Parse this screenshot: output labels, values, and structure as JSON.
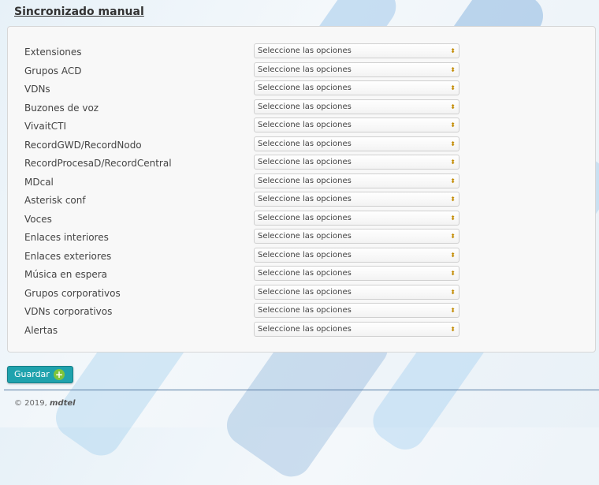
{
  "page": {
    "title": "Sincronizado manual"
  },
  "form": {
    "rows": [
      {
        "label": "Extensiones",
        "value": "Seleccione las opciones"
      },
      {
        "label": "Grupos ACD",
        "value": "Seleccione las opciones"
      },
      {
        "label": "VDNs",
        "value": "Seleccione las opciones"
      },
      {
        "label": "Buzones de voz",
        "value": "Seleccione las opciones"
      },
      {
        "label": "VivaitCTI",
        "value": "Seleccione las opciones"
      },
      {
        "label": "RecordGWD/RecordNodo",
        "value": "Seleccione las opciones"
      },
      {
        "label": "RecordProcesaD/RecordCentral",
        "value": "Seleccione las opciones"
      },
      {
        "label": "MDcal",
        "value": "Seleccione las opciones"
      },
      {
        "label": "Asterisk conf",
        "value": "Seleccione las opciones"
      },
      {
        "label": "Voces",
        "value": "Seleccione las opciones"
      },
      {
        "label": "Enlaces interiores",
        "value": "Seleccione las opciones"
      },
      {
        "label": "Enlaces exteriores",
        "value": "Seleccione las opciones"
      },
      {
        "label": "Música en espera",
        "value": "Seleccione las opciones"
      },
      {
        "label": "Grupos corporativos",
        "value": "Seleccione las opciones"
      },
      {
        "label": "VDNs corporativos",
        "value": "Seleccione las opciones"
      },
      {
        "label": "Alertas",
        "value": "Seleccione las opciones"
      }
    ],
    "arrow_glyph": "⬍"
  },
  "actions": {
    "save_label": "Guardar",
    "save_icon": "plus-icon",
    "save_icon_glyph": "+"
  },
  "footer": {
    "copyright": "© 2019,",
    "brand": "mdtel"
  },
  "colors": {
    "accent": "#1fa2ad",
    "icon_green": "#7fc43b"
  }
}
